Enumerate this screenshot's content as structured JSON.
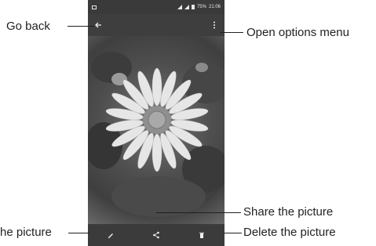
{
  "status_bar": {
    "battery_percent": "75%",
    "time": "21:06"
  },
  "callouts": {
    "go_back": "Go back",
    "open_options": "Open options menu",
    "share": "Share the picture",
    "edit": "he picture",
    "delete": "Delete the picture"
  },
  "icons": {
    "back": "arrow-left-icon",
    "menu": "more-vert-icon",
    "edit": "pencil-icon",
    "share": "share-icon",
    "delete": "trash-icon"
  },
  "colors": {
    "bars": "#3b3b3b",
    "icons": "#f0f0f0"
  }
}
